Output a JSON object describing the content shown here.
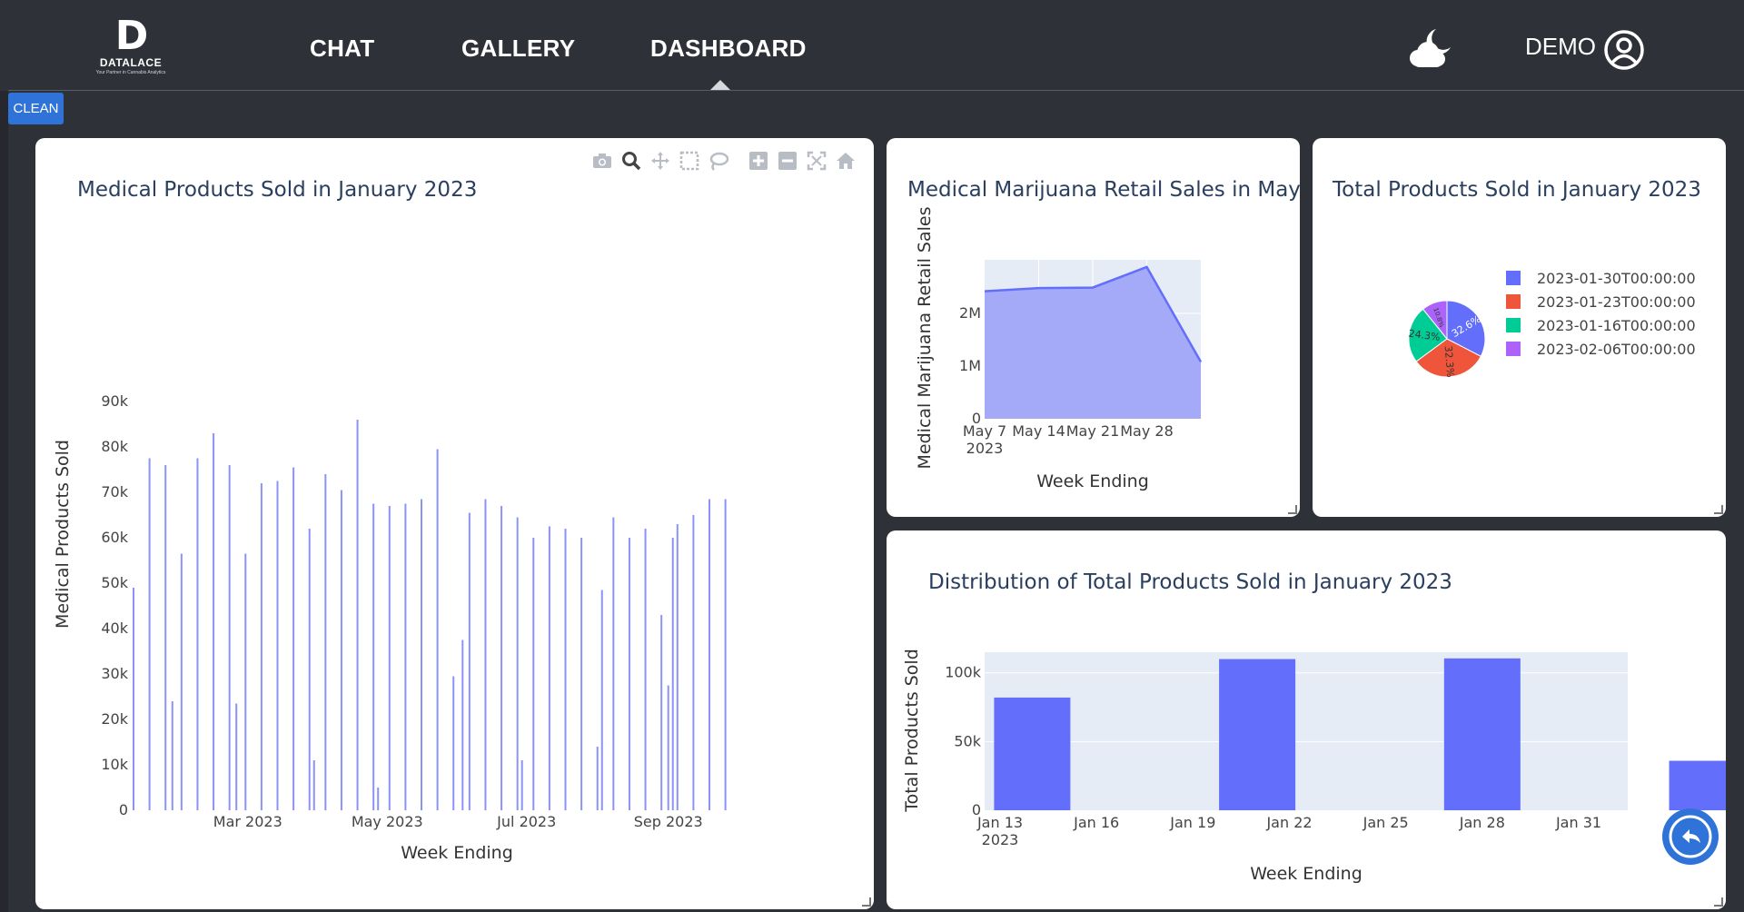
{
  "brand": {
    "name": "DATALACE",
    "tagline": "Your Partner in Cannabis Analytics"
  },
  "nav": {
    "items": [
      {
        "label": "CHAT"
      },
      {
        "label": "GALLERY"
      },
      {
        "label": "DASHBOARD",
        "active": true
      }
    ]
  },
  "user": {
    "label": "DEMO",
    "theme_icon": "cloud-moon-icon",
    "avatar_icon": "user-circle-icon"
  },
  "toolbar": {
    "clean_label": "CLEAN"
  },
  "colors": {
    "background": "#2f3138",
    "accent": "#2f73d9",
    "bar": "#636efa",
    "plot_bg": "#e5ecf6",
    "title": "#2a3f5f"
  },
  "modebar_icons": [
    "camera-icon",
    "zoom-icon",
    "pan-icon",
    "box-select-icon",
    "lasso-icon",
    "zoom-in-icon",
    "zoom-out-icon",
    "autoscale-icon",
    "home-icon"
  ],
  "charts": {
    "medical": {
      "title": "Medical Products Sold in January 2023"
    },
    "retail": {
      "title": "Medical Marijuana Retail Sales in May"
    },
    "pie": {
      "title": "Total Products Sold in January 2023"
    },
    "distribution": {
      "title": "Distribution of Total Products Sold in January 2023"
    }
  },
  "chart_data": [
    {
      "id": "medical",
      "type": "bar",
      "title": "Medical Products Sold in January 2023",
      "xlabel": "Week Ending",
      "ylabel": "Medical Products Sold",
      "ylim": [
        0,
        90000
      ],
      "yticks": [
        "0",
        "10k",
        "20k",
        "30k",
        "40k",
        "50k",
        "60k",
        "70k",
        "80k",
        "90k"
      ],
      "xticks": [
        "Mar 2023",
        "May 2023",
        "Jul 2023",
        "Sep 2023"
      ],
      "xtick_dates": [
        "2023-03-01",
        "2023-05-01",
        "2023-07-01",
        "2023-09-01"
      ],
      "xlim": [
        "2023-01-10",
        "2023-10-20"
      ],
      "x": [
        "2023-01-10",
        "2023-01-17",
        "2023-01-24",
        "2023-01-27",
        "2023-01-31",
        "2023-02-07",
        "2023-02-14",
        "2023-02-21",
        "2023-02-24",
        "2023-02-28",
        "2023-03-07",
        "2023-03-14",
        "2023-03-21",
        "2023-03-28",
        "2023-03-30",
        "2023-04-04",
        "2023-04-11",
        "2023-04-18",
        "2023-04-25",
        "2023-04-27",
        "2023-05-02",
        "2023-05-09",
        "2023-05-16",
        "2023-05-23",
        "2023-05-30",
        "2023-06-03",
        "2023-06-06",
        "2023-06-13",
        "2023-06-20",
        "2023-06-27",
        "2023-06-29",
        "2023-07-04",
        "2023-07-11",
        "2023-07-18",
        "2023-07-25",
        "2023-08-01",
        "2023-08-03",
        "2023-08-08",
        "2023-08-15",
        "2023-08-22",
        "2023-08-29",
        "2023-09-01",
        "2023-09-03",
        "2023-09-05",
        "2023-09-12",
        "2023-09-19",
        "2023-09-26"
      ],
      "values": [
        49000,
        77500,
        76000,
        24000,
        56500,
        77500,
        83000,
        76000,
        23500,
        56500,
        72000,
        72500,
        75500,
        62000,
        11000,
        74000,
        70500,
        86000,
        67500,
        5000,
        67000,
        67500,
        68500,
        79500,
        29500,
        37500,
        65500,
        68500,
        67000,
        64500,
        11000,
        60000,
        62500,
        62000,
        60000,
        14000,
        48500,
        64500,
        60000,
        62000,
        43000,
        27500,
        60000,
        63000,
        65000,
        68500,
        68500
      ]
    },
    {
      "id": "retail",
      "type": "area",
      "title": "Medical Marijuana Retail Sales in May",
      "xlabel": "Week Ending",
      "ylabel": "Medical Marijuana Retail Sales",
      "ylim": [
        0,
        3000000
      ],
      "yticks": [
        "0",
        "1M",
        "2M"
      ],
      "xticks": [
        "May 7\n2023",
        "May 14",
        "May 21",
        "May 28"
      ],
      "x": [
        "2023-05-07",
        "2023-05-14",
        "2023-05-21",
        "2023-05-28",
        "2023-06-04"
      ],
      "values": [
        2420000,
        2480000,
        2490000,
        2880000,
        1080000
      ]
    },
    {
      "id": "pie",
      "type": "pie",
      "title": "Total Products Sold in January 2023",
      "labels": [
        "2023-01-30T00:00:00",
        "2023-01-23T00:00:00",
        "2023-01-16T00:00:00",
        "2023-02-06T00:00:00"
      ],
      "values": [
        32.6,
        32.3,
        24.3,
        10.8
      ],
      "slice_labels": [
        "32.6%",
        "32.3%",
        "24.3%",
        "10.8%"
      ],
      "colors": [
        "#636efa",
        "#ef553b",
        "#00cc96",
        "#ab63fa"
      ],
      "legend": "right"
    },
    {
      "id": "distribution",
      "type": "bar",
      "title": "Distribution of Total Products Sold in January 2023",
      "xlabel": "Week Ending",
      "ylabel": "Total Products Sold",
      "ylim": [
        0,
        115000
      ],
      "yticks": [
        "0",
        "50k",
        "100k"
      ],
      "xticks": [
        "Jan 13\n2023",
        "Jan 16",
        "Jan 19",
        "Jan 22",
        "Jan 25",
        "Jan 28",
        "Jan 31"
      ],
      "x": [
        "2023-01-14",
        "2023-01-21",
        "2023-01-28",
        "2023-02-04"
      ],
      "values": [
        82000,
        110000,
        110500,
        36000
      ]
    }
  ]
}
